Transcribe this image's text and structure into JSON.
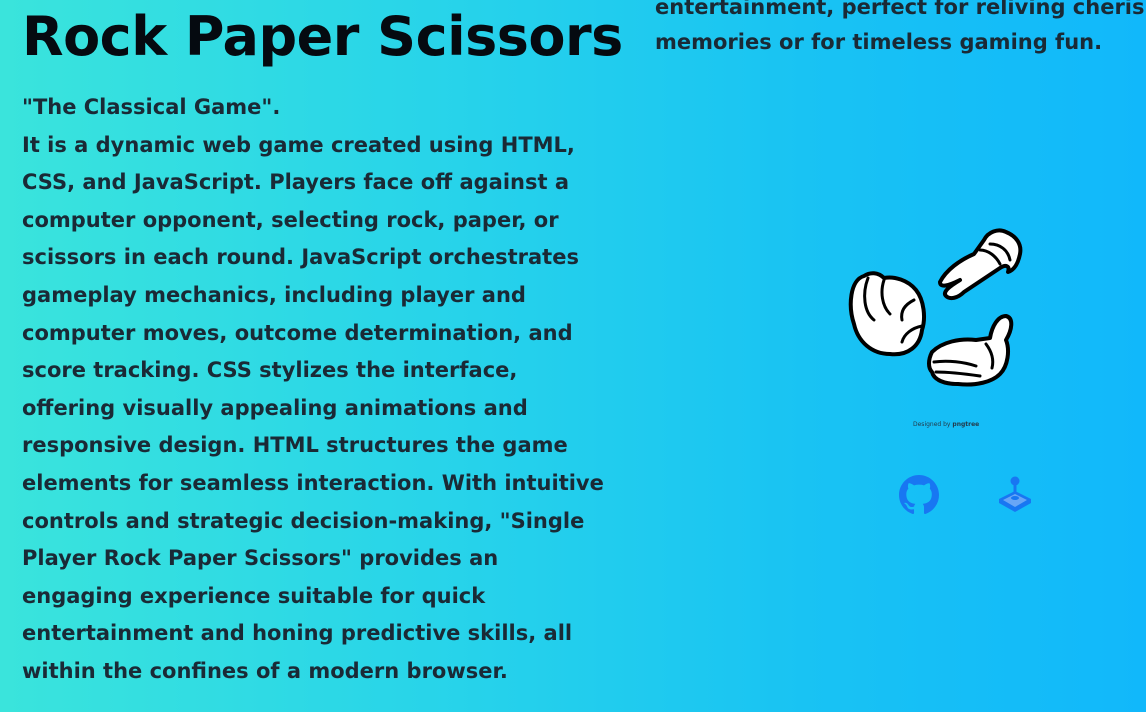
{
  "header": {
    "title": "Rock Paper Scissors"
  },
  "description": {
    "tagline": "\"The Classical Game\".",
    "body": "It is a dynamic web game created using HTML, CSS, and JavaScript. Players face off against a computer opponent, selecting rock, paper, or scissors in each round. JavaScript orchestrates gameplay mechanics, including player and computer moves, outcome determination, and score tracking. CSS stylizes the interface, offering visually appealing animations and responsive design. HTML structures the game elements for seamless interaction. With intuitive controls and strategic decision-making, \"Single Player Rock Paper Scissors\" provides an engaging experience suitable for quick entertainment and honing predictive skills, all within the confines of a modern browser."
  },
  "right_column": {
    "line1": "entertainment, perfect for reliving cherished",
    "line2": "memories or for timeless gaming fun."
  },
  "image": {
    "credit_prefix": "Designed by",
    "credit_brand": "pngtree"
  },
  "links": [
    {
      "icon": "github-icon"
    },
    {
      "icon": "joystick-icon"
    }
  ],
  "colors": {
    "gradient_start": "#3ae4dc",
    "gradient_end": "#11b8fb",
    "icon_blue": "#1877f2",
    "text": "#1a2a36"
  }
}
